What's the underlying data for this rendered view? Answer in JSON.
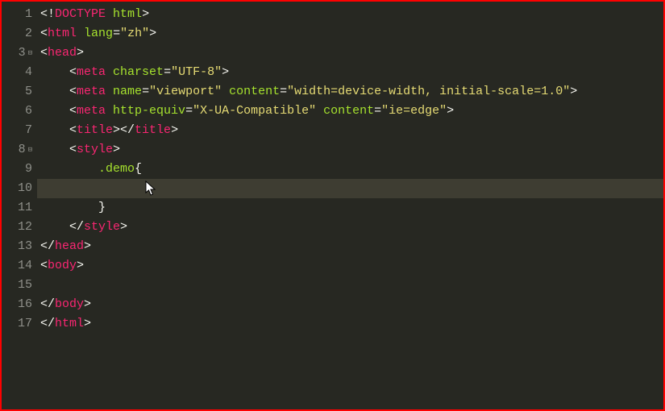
{
  "editor": {
    "active_line": 10,
    "fold_lines": [
      3,
      8
    ],
    "lines": [
      {
        "num": 1,
        "tokens": [
          [
            "p",
            "<!"
          ],
          [
            "t",
            "DOCTYPE"
          ],
          [
            "p",
            " "
          ],
          [
            "a",
            "html"
          ],
          [
            "p",
            ">"
          ]
        ]
      },
      {
        "num": 2,
        "tokens": [
          [
            "p",
            "<"
          ],
          [
            "t",
            "html"
          ],
          [
            "p",
            " "
          ],
          [
            "a",
            "lang"
          ],
          [
            "p",
            "="
          ],
          [
            "s",
            "\"zh\""
          ],
          [
            "p",
            ">"
          ]
        ]
      },
      {
        "num": 3,
        "tokens": [
          [
            "p",
            "<"
          ],
          [
            "t",
            "head"
          ],
          [
            "p",
            ">"
          ]
        ]
      },
      {
        "num": 4,
        "tokens": [
          [
            "p",
            "    <"
          ],
          [
            "t",
            "meta"
          ],
          [
            "p",
            " "
          ],
          [
            "a",
            "charset"
          ],
          [
            "p",
            "="
          ],
          [
            "s",
            "\"UTF-8\""
          ],
          [
            "p",
            ">"
          ]
        ]
      },
      {
        "num": 5,
        "tokens": [
          [
            "p",
            "    <"
          ],
          [
            "t",
            "meta"
          ],
          [
            "p",
            " "
          ],
          [
            "a",
            "name"
          ],
          [
            "p",
            "="
          ],
          [
            "s",
            "\"viewport\""
          ],
          [
            "p",
            " "
          ],
          [
            "a",
            "content"
          ],
          [
            "p",
            "="
          ],
          [
            "s",
            "\"width=device-width, initial-scale=1.0\""
          ],
          [
            "p",
            ">"
          ]
        ]
      },
      {
        "num": 6,
        "tokens": [
          [
            "p",
            "    <"
          ],
          [
            "t",
            "meta"
          ],
          [
            "p",
            " "
          ],
          [
            "a",
            "http-equiv"
          ],
          [
            "p",
            "="
          ],
          [
            "s",
            "\"X-UA-Compatible\""
          ],
          [
            "p",
            " "
          ],
          [
            "a",
            "content"
          ],
          [
            "p",
            "="
          ],
          [
            "s",
            "\"ie=edge\""
          ],
          [
            "p",
            ">"
          ]
        ]
      },
      {
        "num": 7,
        "tokens": [
          [
            "p",
            "    <"
          ],
          [
            "t",
            "title"
          ],
          [
            "p",
            "></"
          ],
          [
            "t",
            "title"
          ],
          [
            "p",
            ">"
          ]
        ]
      },
      {
        "num": 8,
        "tokens": [
          [
            "p",
            "    <"
          ],
          [
            "t",
            "style"
          ],
          [
            "p",
            ">"
          ]
        ]
      },
      {
        "num": 9,
        "tokens": [
          [
            "p",
            "        "
          ],
          [
            "sel",
            ".demo"
          ],
          [
            "p",
            "{"
          ]
        ]
      },
      {
        "num": 10,
        "tokens": [
          [
            "p",
            "            "
          ]
        ]
      },
      {
        "num": 11,
        "tokens": [
          [
            "p",
            "        }"
          ]
        ]
      },
      {
        "num": 12,
        "tokens": [
          [
            "p",
            "    </"
          ],
          [
            "t",
            "style"
          ],
          [
            "p",
            ">"
          ]
        ]
      },
      {
        "num": 13,
        "tokens": [
          [
            "p",
            "</"
          ],
          [
            "t",
            "head"
          ],
          [
            "p",
            ">"
          ]
        ]
      },
      {
        "num": 14,
        "tokens": [
          [
            "p",
            "<"
          ],
          [
            "t",
            "body"
          ],
          [
            "p",
            ">"
          ]
        ]
      },
      {
        "num": 15,
        "tokens": [
          [
            "p",
            ""
          ]
        ]
      },
      {
        "num": 16,
        "tokens": [
          [
            "p",
            "</"
          ],
          [
            "t",
            "body"
          ],
          [
            "p",
            ">"
          ]
        ]
      },
      {
        "num": 17,
        "tokens": [
          [
            "p",
            "</"
          ],
          [
            "t",
            "html"
          ],
          [
            "p",
            ">"
          ]
        ]
      }
    ]
  }
}
